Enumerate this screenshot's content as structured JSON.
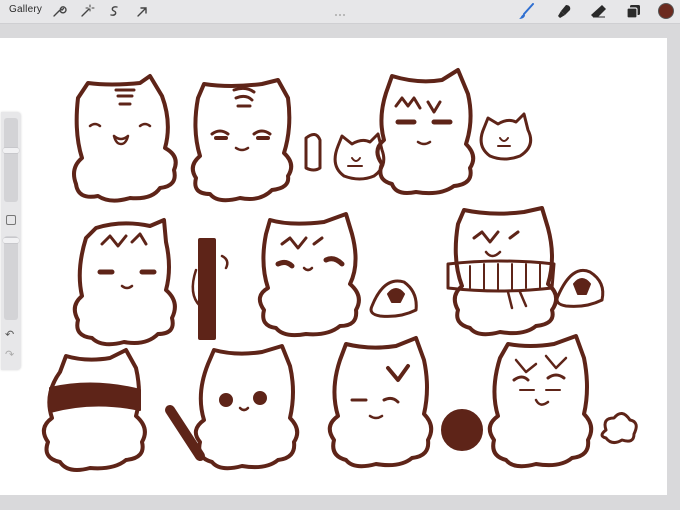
{
  "app": {
    "gallery_label": "Gallery"
  },
  "toolbar": {
    "left_tools": [
      "wrench-icon",
      "magic-wand-icon",
      "selection-icon",
      "transform-arrow-icon"
    ],
    "right_tools": [
      "brush-icon",
      "smudge-icon",
      "eraser-icon",
      "layers-icon"
    ],
    "active_tool": "brush-icon",
    "current_color": "#6b2a1f",
    "accent_color": "#2f6fd1"
  },
  "sidebar": {
    "brush_size_level": 0.8,
    "opacity_level": 0.95,
    "undo_icon": "undo-icon",
    "redo_icon": "redo-icon"
  },
  "canvas": {
    "ink_color": "#5e2418"
  }
}
